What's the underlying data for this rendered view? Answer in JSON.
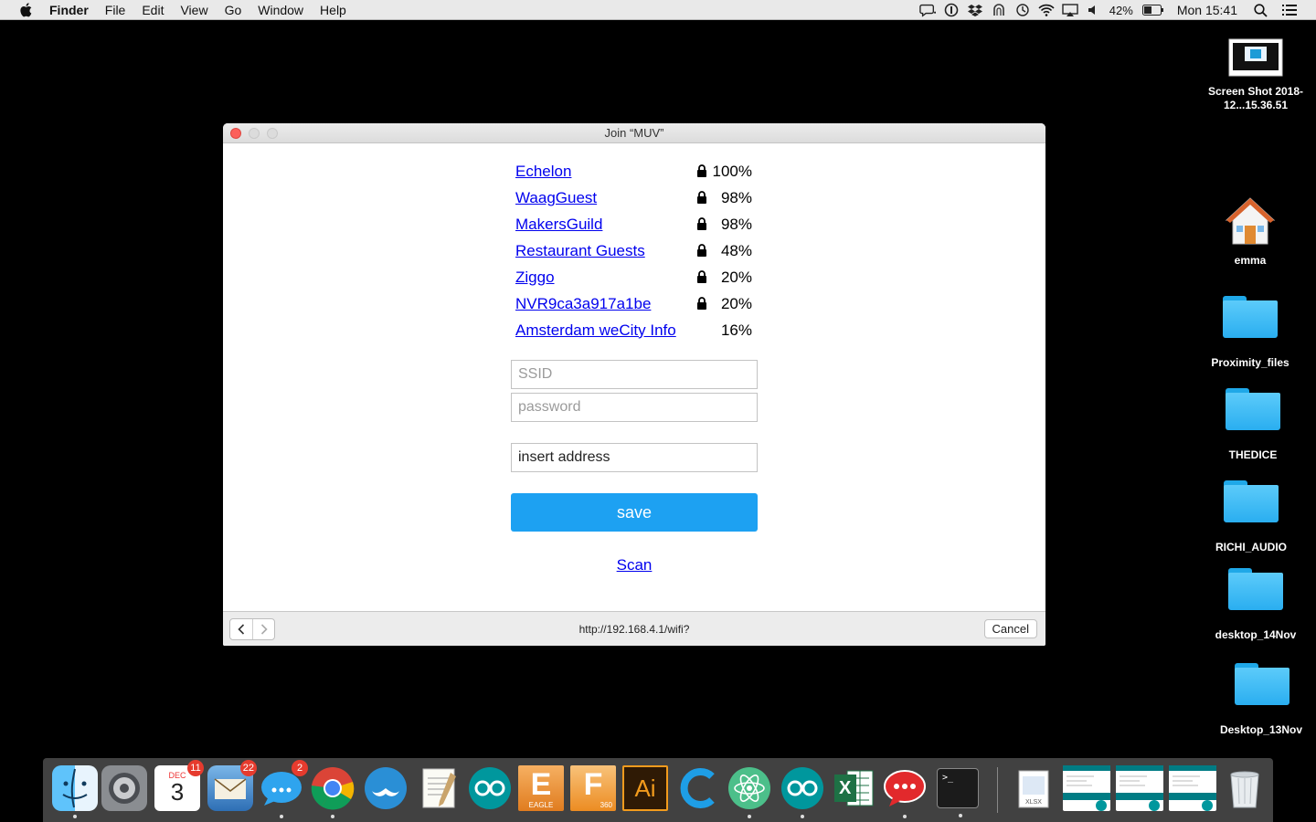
{
  "menubar": {
    "app_name": "Finder",
    "items": [
      "File",
      "Edit",
      "View",
      "Go",
      "Window",
      "Help"
    ],
    "battery_percent": "42%",
    "clock": "Mon 15:41"
  },
  "desktop": {
    "items": [
      {
        "label": "Screen Shot 2018-12...15.36.51",
        "icon": "screenshot-icon"
      },
      {
        "label": "emma",
        "icon": "home-folder-icon"
      },
      {
        "label": "Proximity_files",
        "icon": "folder-icon"
      },
      {
        "label": "THEDICE",
        "icon": "folder-icon"
      },
      {
        "label": "RICHI_AUDIO",
        "icon": "folder-icon"
      },
      {
        "label": "desktop_14Nov",
        "icon": "folder-icon"
      },
      {
        "label": "Desktop_13Nov",
        "icon": "folder-icon"
      }
    ]
  },
  "window": {
    "title": "Join “MUV”",
    "networks": [
      {
        "ssid": "Echelon",
        "strength": "100%",
        "locked": true
      },
      {
        "ssid": "WaagGuest",
        "strength": "98%",
        "locked": true
      },
      {
        "ssid": "MakersGuild",
        "strength": "98%",
        "locked": true
      },
      {
        "ssid": "Restaurant Guests",
        "strength": "48%",
        "locked": true
      },
      {
        "ssid": "Ziggo",
        "strength": "20%",
        "locked": true
      },
      {
        "ssid": "NVR9ca3a917a1be",
        "strength": "20%",
        "locked": true
      },
      {
        "ssid": "Amsterdam weCity Info",
        "strength": "16%",
        "locked": false
      }
    ],
    "form": {
      "ssid_placeholder": "SSID",
      "password_placeholder": "password",
      "address_value": "insert address",
      "save_label": "save",
      "scan_label": "Scan"
    },
    "url": "http://192.168.4.1/wifi?",
    "cancel_label": "Cancel"
  },
  "dock": {
    "calendar_month": "DEC",
    "calendar_day": "3",
    "calendar_badge": "11",
    "mail_badge": "22",
    "messages_badge": "2",
    "eagle_label": "EAGLE",
    "fusion_label": "360",
    "illustrator_label": "Ai",
    "excel_label": "X"
  }
}
